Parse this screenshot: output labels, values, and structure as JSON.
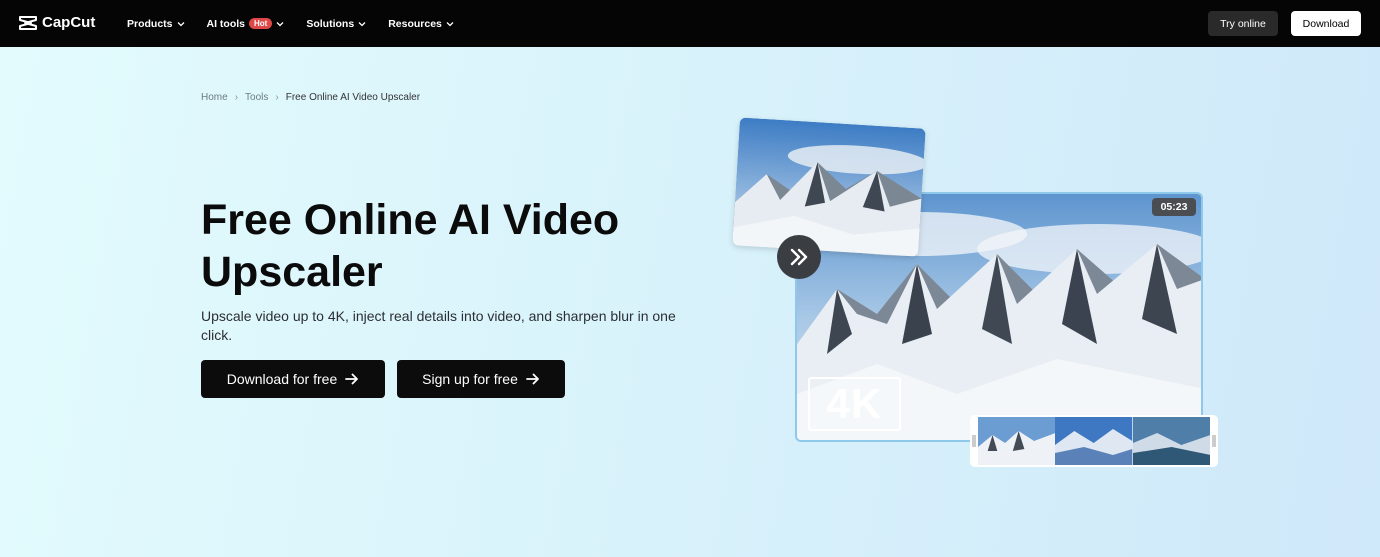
{
  "brand": {
    "name": "CapCut"
  },
  "nav": {
    "items": [
      {
        "label": "Products"
      },
      {
        "label": "AI tools",
        "badge": "Hot"
      },
      {
        "label": "Solutions"
      },
      {
        "label": "Resources"
      }
    ],
    "try_online": "Try online",
    "download": "Download"
  },
  "breadcrumb": [
    "Home",
    "Tools",
    "Free Online AI Video Upscaler"
  ],
  "hero": {
    "title_line1": "Free Online AI Video",
    "title_line2": "Upscaler",
    "subtitle": "Upscale video up to 4K, inject real details into video, and sharpen blur in one click.",
    "cta_download": "Download for free",
    "cta_signup": "Sign up for free"
  },
  "preview": {
    "duration": "05:23",
    "resolution_badge": "4K"
  },
  "colors": {
    "nav_bg": "#050505",
    "hot_badge": "#e04848",
    "cta_bg": "#0c0c0c"
  }
}
